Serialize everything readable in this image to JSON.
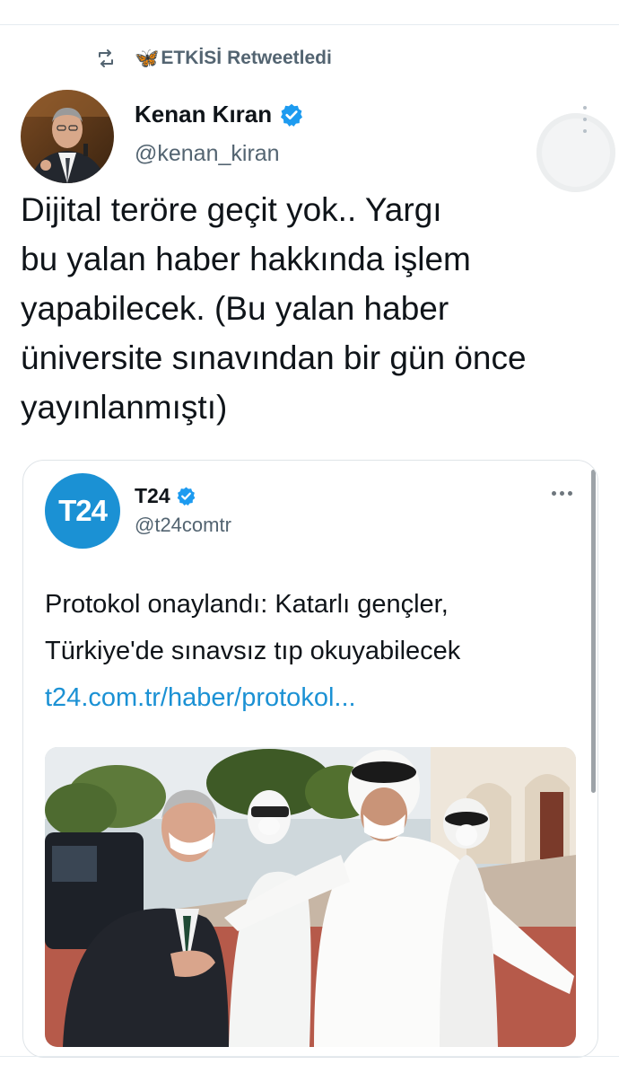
{
  "retweet": {
    "user": "ETKİSİ",
    "butterfly": "🦋",
    "suffix": "Retweetledi",
    "icon": "retweet-icon"
  },
  "tweet": {
    "display_name": "Kenan Kıran",
    "handle": "@kenan_kiran",
    "verified": true,
    "text": "Dijital teröre geçit yok.. Yargı\nbu yalan haber hakkında işlem\nyapabilecek. (Bu yalan haber\nüniversite sınavından bir gün önce\nyayınlanmıştı)"
  },
  "quote": {
    "logo_text": "T24",
    "display_name": "T24",
    "handle": "@t24comtr",
    "verified": true,
    "text_line1": "Protokol onaylandı: Katarlı gençler,",
    "text_line2": "Türkiye'de sınavsız tıp okuyabilecek",
    "link": "t24.com.tr/haber/protokol..."
  },
  "colors": {
    "accent": "#1d9bf0",
    "t24_brand": "#1b91d4",
    "secondary_text": "#536471"
  }
}
